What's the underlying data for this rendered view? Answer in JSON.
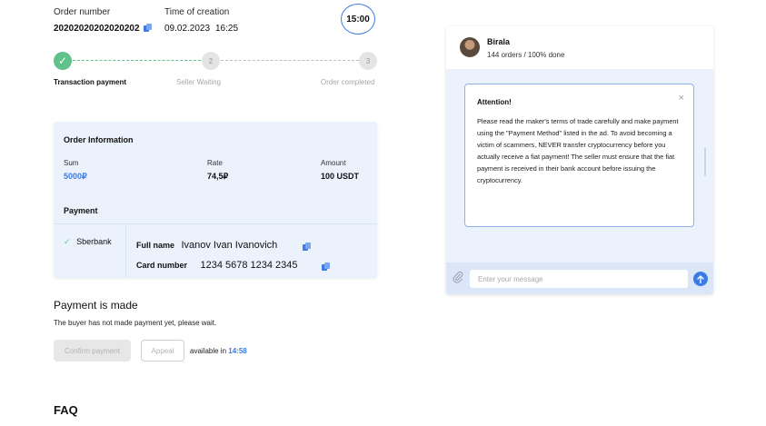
{
  "order": {
    "number_label": "Order number",
    "number_value": "20202020202020202",
    "time_label": "Time of creation",
    "date_value": "09.02.2023",
    "time_value": "16:25",
    "timer": "15:00"
  },
  "steps": [
    {
      "index": "",
      "label": "Transaction payment",
      "status": "done"
    },
    {
      "index": "2",
      "label": "Seller Waiting",
      "status": "pending"
    },
    {
      "index": "3",
      "label": "Order completed",
      "status": "pending"
    }
  ],
  "order_info": {
    "title": "Order Information",
    "sum_label": "Sum",
    "sum_value": "5000₽",
    "rate_label": "Rate",
    "rate_value": "74,5₽",
    "amount_label": "Amount",
    "amount_value": "100 USDT",
    "payment_title": "Payment",
    "method": "Sberbank",
    "full_name_label": "Full name",
    "full_name_value": "Ivanov Ivan Ivanovich",
    "card_label": "Card number",
    "card_value": "1234 5678 1234 2345"
  },
  "payment_made": {
    "title": "Payment is made",
    "text": "The buyer has not made payment yet, please wait.",
    "confirm_label": "Confirm payment",
    "appeal_label": "Appeal",
    "available_text": "available in",
    "available_time": "14:58"
  },
  "faq": {
    "title": "FAQ"
  },
  "chat": {
    "name": "Birala",
    "stats": "144 orders / 100% done",
    "attention_title": "Attention!",
    "attention_text": "Please read the maker's terms of trade carefully and make payment using the \"Payment Method\" listed in the ad. To avoid becoming a victim of scammers, NEVER transfer cryptocurrency before you actually receive a fiat payment! The seller must ensure that the fiat payment is received in their bank account before issuing the cryptocurrency.",
    "close_glyph": "×",
    "input_placeholder": "Enter your message"
  },
  "icons": {
    "copy": "copy-icon",
    "check": "check-icon",
    "close": "close-icon",
    "attach": "paperclip-icon",
    "send": "send-arrow-icon"
  },
  "colors": {
    "accent": "#3c7be6",
    "success": "#5ec28a",
    "card_bg": "#ebf2fc"
  }
}
